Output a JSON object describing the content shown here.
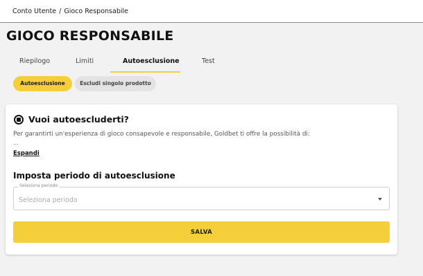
{
  "breadcrumb": {
    "parent": "Conto Utente",
    "separator": "/",
    "current": "Gioco Responsabile"
  },
  "page_title": "GIOCO RESPONSABILE",
  "tabs": [
    {
      "label": "Riepilogo",
      "active": false
    },
    {
      "label": "Limiti",
      "active": false
    },
    {
      "label": "Autoesclusione",
      "active": true
    },
    {
      "label": "Test",
      "active": false
    }
  ],
  "pills": [
    {
      "label": "Autoesclusione",
      "active": true
    },
    {
      "label": "Escludi singolo prodotto",
      "active": false
    }
  ],
  "card": {
    "heading": "Vuoi autoescluderti?",
    "heading_icon": "stop-circle-icon",
    "description": "Per garantirti un'esperienza di gioco consapevole e responsabile, Goldbet ti offre la possibilità di:",
    "ellipsis": "...",
    "expand_link": "Espandi",
    "period_title": "Imposta periodo di autoesclusione",
    "period_select": {
      "label": "Seleziona periodo",
      "placeholder": "Seleziona periodo",
      "arrow_icon": "dropdown-arrow-icon"
    },
    "save_label": "SALVA"
  },
  "colors": {
    "accent": "#f5cf3a",
    "inactive_pill": "#e3e3e3",
    "background": "#f2f2f2",
    "card": "#ffffff"
  }
}
